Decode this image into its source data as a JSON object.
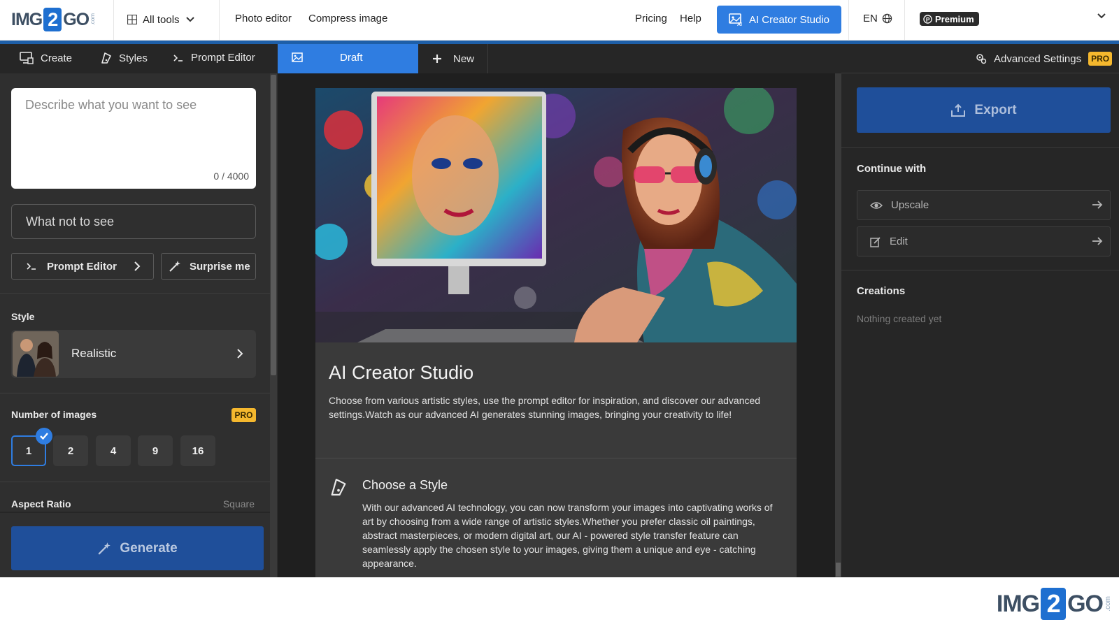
{
  "header": {
    "logo": {
      "left": "IMG",
      "two": "2",
      "right": "GO",
      "com": ".com"
    },
    "all_tools": "All tools",
    "nav": [
      "Photo editor",
      "Compress image",
      "Pricing",
      "Help"
    ],
    "studio_button": "AI Creator Studio",
    "language": "EN",
    "premium": "Premium"
  },
  "left": {
    "tabs": [
      "Create",
      "Styles",
      "Prompt Editor"
    ],
    "prompt_placeholder": "Describe what you want to see",
    "prompt_count": "0 / 4000",
    "negative_placeholder": "What not to see",
    "prompt_editor_button": "Prompt Editor",
    "surprise_button": "Surprise me",
    "style_label": "Style",
    "style_value": "Realistic",
    "images_label": "Number of images",
    "pro": "PRO",
    "image_options": [
      "1",
      "2",
      "4",
      "9",
      "16"
    ],
    "images_selected": "1",
    "aspect_label": "Aspect Ratio",
    "aspect_value": "Square",
    "generate": "Generate"
  },
  "center": {
    "tabs": {
      "draft": "Draft",
      "new": "New"
    },
    "card_title": "AI Creator Studio",
    "card_desc": "Choose from various artistic styles, use the prompt editor for inspiration, and discover our advanced settings.Watch as our advanced AI generates stunning images, bringing your creativity to life!",
    "section_title": "Choose a Style",
    "section_desc": "With our advanced AI technology, you can now transform your images into captivating works of art by choosing from a wide range of artistic styles.Whether you prefer classic oil paintings, abstract masterpieces, or modern digital art, our AI - powered style transfer feature can seamlessly apply the chosen style to your images, giving them a unique and eye - catching appearance."
  },
  "right": {
    "advanced_settings": "Advanced Settings",
    "pro": "PRO",
    "export": "Export",
    "continue_with": "Continue with",
    "continue_items": [
      "Upscale",
      "Edit"
    ],
    "creations": "Creations",
    "creations_empty": "Nothing created yet"
  },
  "footer": {
    "logo": {
      "left": "IMG",
      "two": "2",
      "right": "GO",
      "com": ".com"
    }
  },
  "colors": {
    "accent_blue": "#2f7de1",
    "brand_dark_blue": "#1e5fa8",
    "action_blue": "#1f4f9a",
    "pro_yellow": "#f5b82e",
    "panel_bg": "#2f2f2f",
    "center_bg": "#1f1f1f"
  },
  "icons": [
    "grid-icon",
    "chevron-down-icon",
    "ai-studio-icon",
    "globe-icon",
    "premium-icon",
    "create-icon",
    "styles-icon",
    "terminal-icon",
    "image-icon",
    "plus-icon",
    "magic-wand-icon",
    "chevron-right-icon",
    "check-icon",
    "settings-icon",
    "export-icon",
    "eye-icon",
    "edit-icon",
    "arrow-right-icon"
  ]
}
